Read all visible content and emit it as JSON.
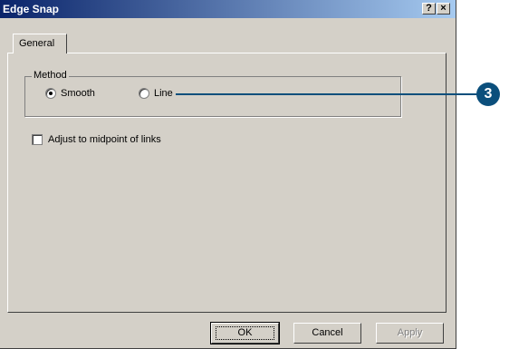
{
  "window": {
    "title": "Edge Snap",
    "help_button": "?",
    "close_button": "×"
  },
  "tabs": [
    {
      "label": "General"
    }
  ],
  "method_group": {
    "label": "Method",
    "options": [
      {
        "label": "Smooth",
        "selected": true
      },
      {
        "label": "Line",
        "selected": false
      }
    ]
  },
  "adjust_checkbox": {
    "label": "Adjust to midpoint of links",
    "checked": false
  },
  "buttons": {
    "ok": "OK",
    "cancel": "Cancel",
    "apply": "Apply"
  },
  "callout": {
    "number": "3",
    "color": "#0b4f7c"
  },
  "icons": {
    "help": "help-icon",
    "close": "close-icon"
  }
}
